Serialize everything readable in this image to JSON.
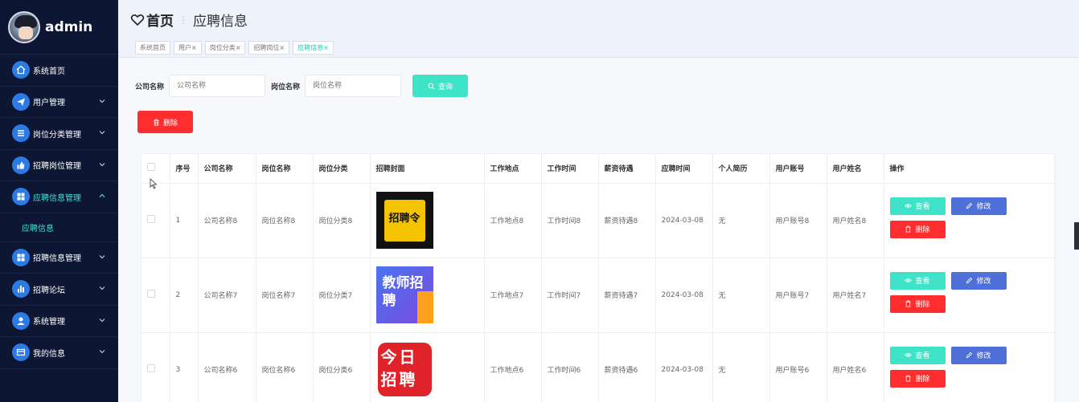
{
  "sidebar": {
    "username": "admin",
    "items": [
      {
        "label": "系统首页",
        "icon": "home-icon"
      },
      {
        "label": "用户管理",
        "icon": "send-icon"
      },
      {
        "label": "岗位分类管理",
        "icon": "list-icon"
      },
      {
        "label": "招聘岗位管理",
        "icon": "thumb-up-icon"
      },
      {
        "label": "应聘信息管理",
        "icon": "grid-icon"
      },
      {
        "label": "招聘信息管理",
        "icon": "grid-icon"
      },
      {
        "label": "招聘论坛",
        "icon": "bar-chart-icon"
      },
      {
        "label": "系统管理",
        "icon": "user-icon"
      },
      {
        "label": "我的信息",
        "icon": "card-icon"
      }
    ],
    "active_submenu": "应聘信息"
  },
  "header": {
    "home": "首页",
    "current": "应聘信息",
    "tags": [
      "系统首页",
      "用户×",
      "岗位分类×",
      "招聘岗位×",
      "应聘信息×"
    ]
  },
  "search": {
    "company_label": "公司名称",
    "company_placeholder": "公司名称",
    "position_label": "岗位名称",
    "position_placeholder": "岗位名称",
    "button": "查询"
  },
  "delete_button": "删除",
  "table": {
    "headers": [
      "序号",
      "公司名称",
      "岗位名称",
      "岗位分类",
      "招聘封面",
      "工作地点",
      "工作时间",
      "薪资待遇",
      "应聘时间",
      "个人简历",
      "用户账号",
      "用户姓名",
      "操作"
    ],
    "rows": [
      {
        "no": "1",
        "company": "公司名称8",
        "position": "岗位名称8",
        "category": "岗位分类8",
        "cover_text": "招聘令",
        "location": "工作地点8",
        "time": "工作时间8",
        "salary": "薪资待遇8",
        "apply_date": "2024-03-08",
        "resume": "无",
        "account": "用户账号8",
        "name": "用户姓名8"
      },
      {
        "no": "2",
        "company": "公司名称7",
        "position": "岗位名称7",
        "category": "岗位分类7",
        "cover_text": "教师招聘",
        "location": "工作地点7",
        "time": "工作时间7",
        "salary": "薪资待遇7",
        "apply_date": "2024-03-08",
        "resume": "无",
        "account": "用户账号7",
        "name": "用户姓名7"
      },
      {
        "no": "3",
        "company": "公司名称6",
        "position": "岗位名称6",
        "category": "岗位分类6",
        "cover_text": "今日招聘",
        "location": "工作地点6",
        "time": "工作时间6",
        "salary": "薪资待遇6",
        "apply_date": "2024-03-08",
        "resume": "无",
        "account": "用户账号6",
        "name": "用户姓名6"
      }
    ],
    "ops": {
      "view": "查看",
      "edit": "修改",
      "delete": "删除"
    }
  },
  "colors": {
    "sidebar_bg": "#0d1633",
    "accent_teal": "#3fe3c8",
    "danger": "#ff2d2d",
    "primary": "#4e70d8"
  }
}
